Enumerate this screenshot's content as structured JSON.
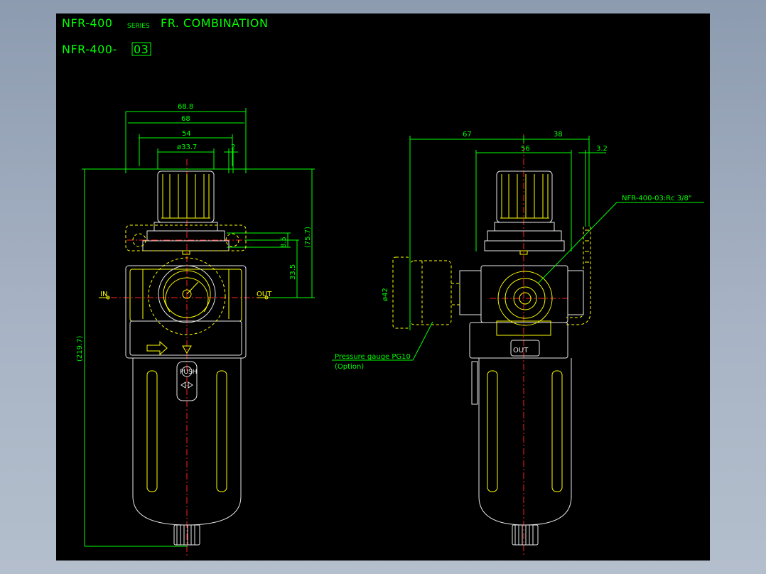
{
  "title": {
    "model": "NFR-400",
    "series": "SERIES",
    "name": "FR. COMBINATION"
  },
  "subtitle": {
    "prefix": "NFR-400-",
    "boxed": "03"
  },
  "front_view": {
    "dims": {
      "w_68_8": "68.8",
      "w_68": "68",
      "w_54": "54",
      "dia_33_7": "ø33.7",
      "gap_2": "2",
      "h_8_5": "8.5",
      "h_75_7": "(75.7)",
      "h_33_5": "33.5",
      "h_219_7": "(219.7)"
    },
    "port_in": "IN",
    "port_out": "OUT",
    "push_label": "PUSH"
  },
  "side_view": {
    "dims": {
      "w_67": "67",
      "w_38": "38",
      "w_56": "56",
      "w_3_2": "3.2",
      "dia_42": "ø42"
    },
    "callout_port": "NFR-400-03:Rc 3/8\"",
    "callout_gauge_line1": "Pressure gauge PG10",
    "callout_gauge_line2": "(Option)",
    "out_label": "OUT"
  },
  "colors": {
    "background": "#000000",
    "dimension": "#00ff00",
    "outline": "#ffff00",
    "centerline": "#ff2020",
    "body": "#e8e8e8"
  }
}
